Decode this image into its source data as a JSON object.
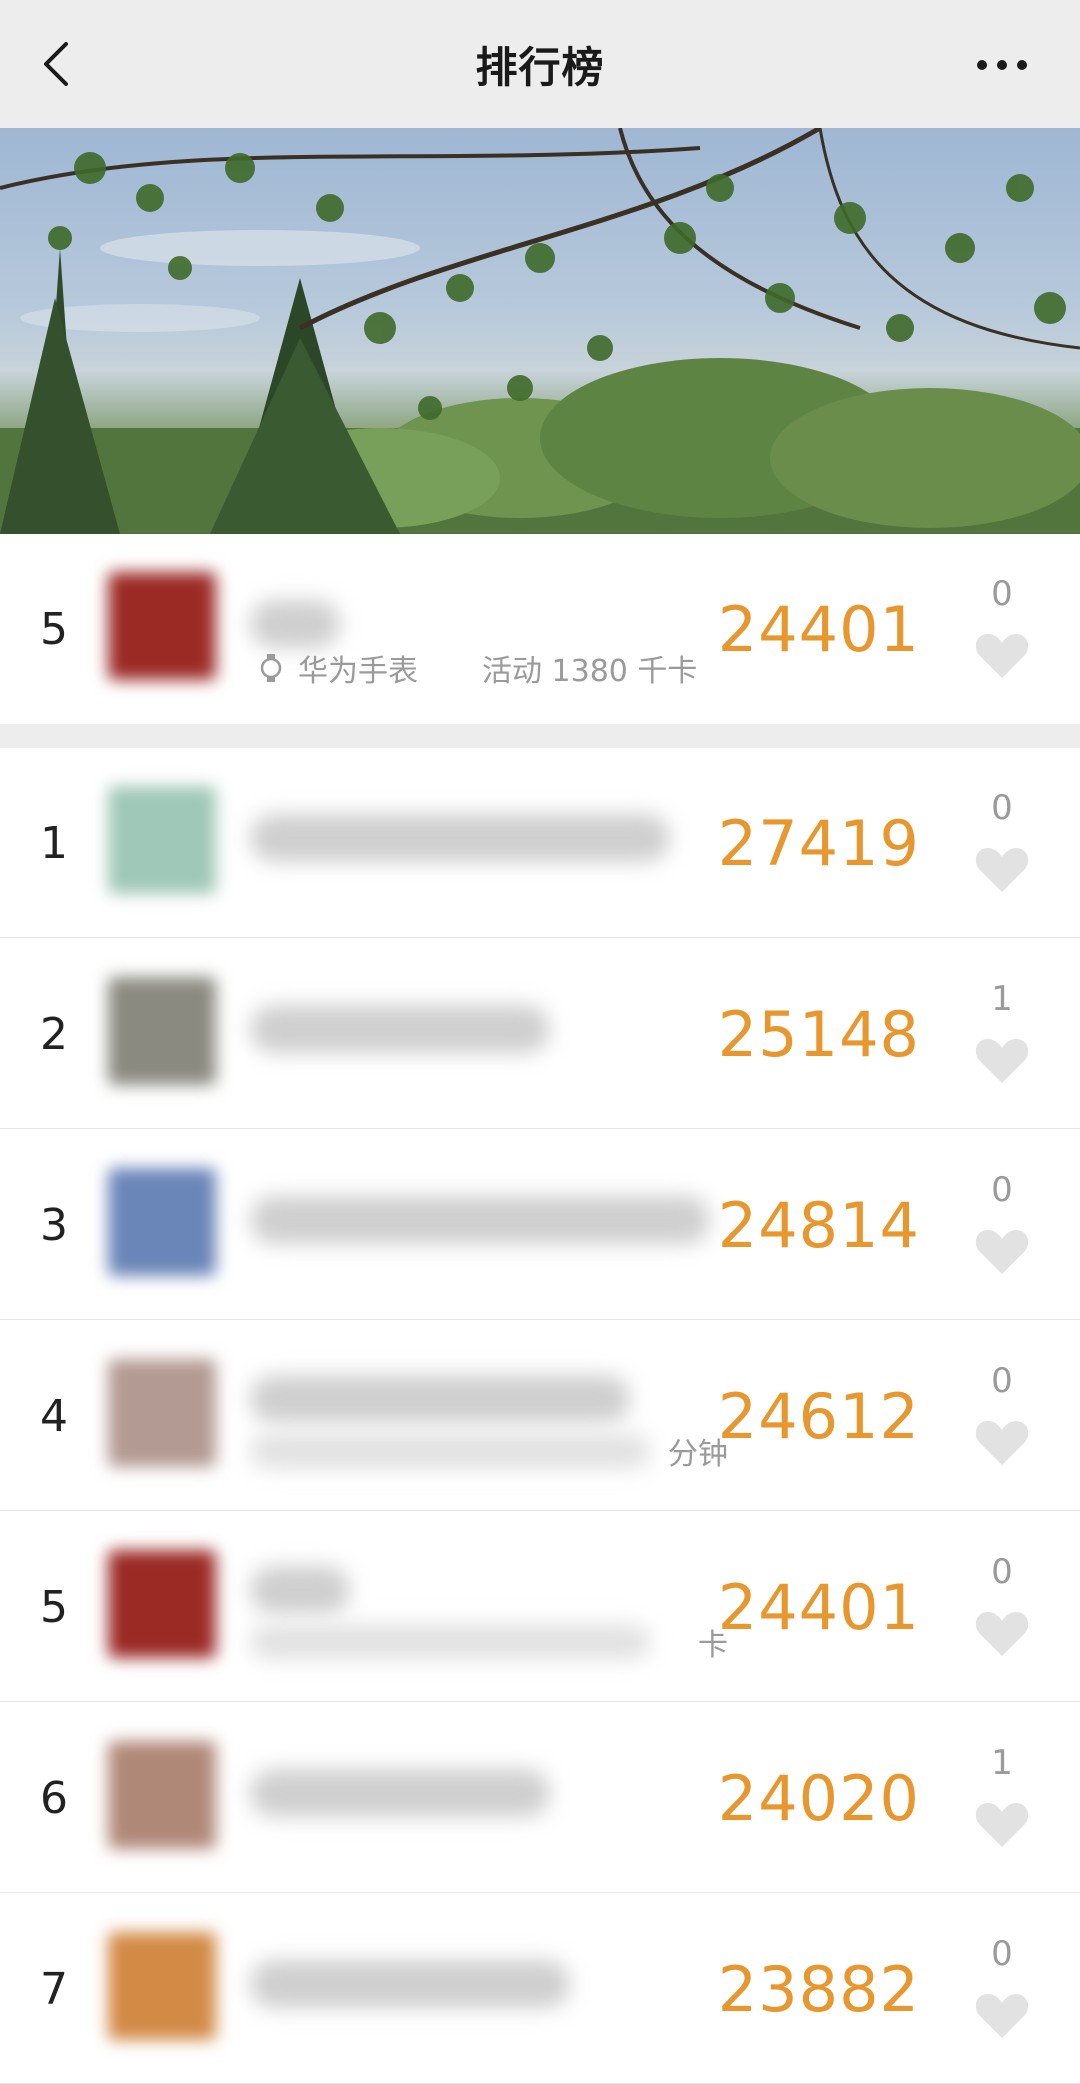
{
  "nav": {
    "title": "排行榜"
  },
  "my_rank": {
    "rank": "5",
    "steps": "24401",
    "likes": "0",
    "device": "华为手表",
    "activity": "活动 1380 千卡"
  },
  "rows": [
    {
      "rank": "1",
      "steps": "27419",
      "likes": "0",
      "avatar_color": "#9fc8b8"
    },
    {
      "rank": "2",
      "steps": "25148",
      "likes": "1",
      "avatar_color": "#8a8a80",
      "tail": ""
    },
    {
      "rank": "3",
      "steps": "24814",
      "likes": "0",
      "avatar_color": "#6a85b8"
    },
    {
      "rank": "4",
      "steps": "24612",
      "likes": "0",
      "avatar_color": "#b39a92",
      "tail": "分钟"
    },
    {
      "rank": "5",
      "steps": "24401",
      "likes": "0",
      "avatar_color": "#9b2a25",
      "tail": "卡"
    },
    {
      "rank": "6",
      "steps": "24020",
      "likes": "1",
      "avatar_color": "#b08878"
    },
    {
      "rank": "7",
      "steps": "23882",
      "likes": "0",
      "avatar_color": "#d28a45"
    }
  ],
  "colors": {
    "accent": "#e8972e",
    "muted": "#9a9a9a",
    "nav_bg": "#ededed"
  },
  "icons": {
    "back": "chevron-left-icon",
    "more": "more-dots-icon",
    "heart": "heart-icon",
    "watch": "watch-icon"
  }
}
